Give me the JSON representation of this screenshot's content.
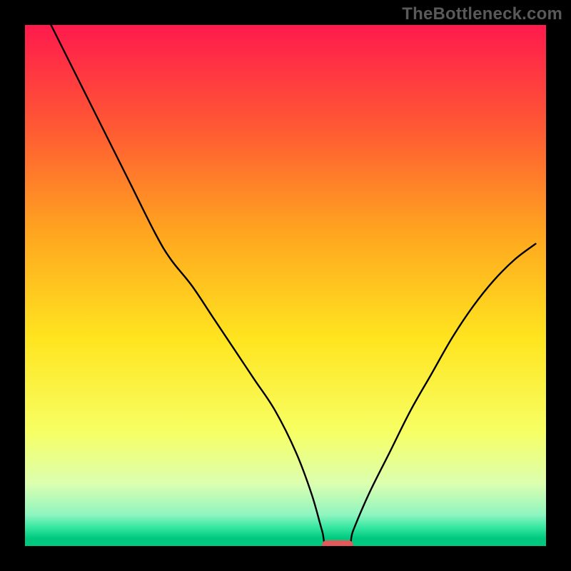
{
  "watermark": "TheBottleneck.com",
  "chart_data": {
    "type": "line",
    "title": "",
    "xlabel": "",
    "ylabel": "",
    "xlim": [
      0,
      100
    ],
    "ylim": [
      0,
      100
    ],
    "grid": false,
    "legend": false,
    "gradient_stops": [
      {
        "offset": 0.0,
        "color": "#ff1a4d"
      },
      {
        "offset": 0.2,
        "color": "#ff5a33"
      },
      {
        "offset": 0.4,
        "color": "#ffa61f"
      },
      {
        "offset": 0.6,
        "color": "#ffe41f"
      },
      {
        "offset": 0.78,
        "color": "#f7ff63"
      },
      {
        "offset": 0.88,
        "color": "#dcffb0"
      },
      {
        "offset": 0.94,
        "color": "#8ff5c0"
      },
      {
        "offset": 0.965,
        "color": "#33e6a0"
      },
      {
        "offset": 0.985,
        "color": "#00c97f"
      },
      {
        "offset": 1.0,
        "color": "#00c97f"
      }
    ],
    "series": [
      {
        "name": "bottleneck-curve",
        "x": [
          5,
          10,
          15,
          20,
          25,
          28,
          32,
          36,
          40,
          44,
          48,
          52,
          55,
          57,
          58,
          62,
          63,
          66,
          70,
          74,
          78,
          82,
          86,
          90,
          94,
          98
        ],
        "y": [
          100,
          90,
          80,
          70,
          60,
          55,
          50,
          44,
          38,
          32,
          26,
          18,
          10,
          3,
          0,
          0,
          3,
          10,
          18,
          26,
          33,
          40,
          46,
          51,
          55,
          58
        ]
      }
    ],
    "marker": {
      "name": "optimal-range",
      "x_center": 60,
      "y": 0,
      "width": 6,
      "color": "#e05a5a"
    }
  }
}
